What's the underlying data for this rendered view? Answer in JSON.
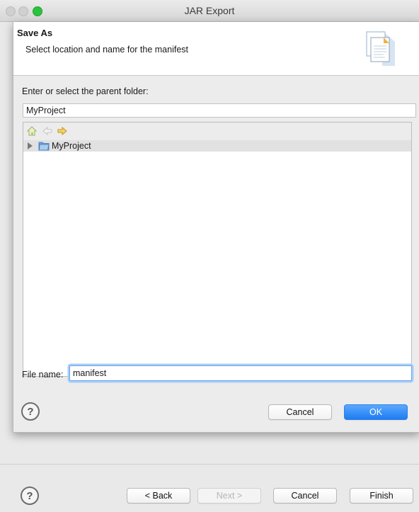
{
  "window": {
    "title": "JAR Export"
  },
  "dialog": {
    "title": "Save As",
    "description": "Select location and name for the manifest",
    "folder_label": "Enter or select the parent folder:",
    "folder_value": "MyProject",
    "tree": {
      "items": [
        {
          "label": "MyProject",
          "expanded": false
        }
      ]
    },
    "filename_label": "File name:",
    "filename_value": "manifest",
    "buttons": {
      "help": "?",
      "cancel": "Cancel",
      "ok": "OK"
    }
  },
  "wizard": {
    "buttons": {
      "help": "?",
      "back": "< Back",
      "next": "Next >",
      "cancel": "Cancel",
      "finish": "Finish"
    }
  },
  "colors": {
    "accent": "#1f7cf1",
    "focus_ring": "#a9cdf8",
    "zoom_button": "#2bc23f"
  },
  "icons": [
    "home-icon",
    "back-arrow-icon",
    "forward-arrow-icon",
    "folder-icon",
    "manifest-document-icon",
    "help-icon"
  ]
}
